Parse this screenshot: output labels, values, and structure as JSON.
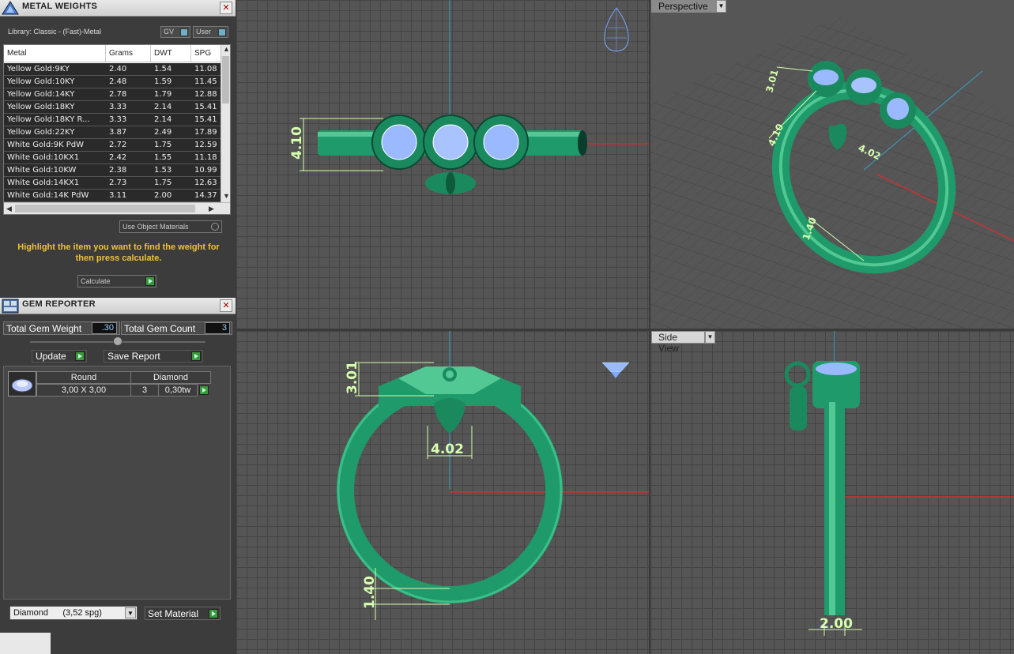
{
  "metal_weights": {
    "title": "METAL WEIGHTS",
    "library": "Library: Classic - (Fast)-Metal",
    "gv_label": "GV",
    "user_label": "User",
    "columns": [
      "Metal",
      "Grams",
      "DWT",
      "SPG"
    ],
    "rows": [
      [
        "Yellow Gold:9KY",
        "2.40",
        "1.54",
        "11.08"
      ],
      [
        "Yellow Gold:10KY",
        "2.48",
        "1.59",
        "11.45"
      ],
      [
        "Yellow Gold:14KY",
        "2.78",
        "1.79",
        "12.88"
      ],
      [
        "Yellow Gold:18KY",
        "3.33",
        "2.14",
        "15.41"
      ],
      [
        "Yellow Gold:18KY R...",
        "3.33",
        "2.14",
        "15.41"
      ],
      [
        "Yellow Gold:22KY",
        "3.87",
        "2.49",
        "17.89"
      ],
      [
        "White Gold:9K PdW",
        "2.72",
        "1.75",
        "12.59"
      ],
      [
        "White Gold:10KX1",
        "2.42",
        "1.55",
        "11.18"
      ],
      [
        "White Gold:10KW",
        "2.38",
        "1.53",
        "10.99"
      ],
      [
        "White Gold:14KX1",
        "2.73",
        "1.75",
        "12.63"
      ],
      [
        "White Gold:14K PdW",
        "3.11",
        "2.00",
        "14.37"
      ]
    ],
    "use_object_materials": "Use Object Materials",
    "hint": "Highlight the item you want to find the weight for then press calculate.",
    "calculate": "Calculate"
  },
  "gem_reporter": {
    "title": "GEM REPORTER",
    "total_weight_label": "Total Gem Weight",
    "total_weight_value": ".30",
    "total_count_label": "Total Gem Count",
    "total_count_value": "3",
    "update_label": "Update",
    "save_report_label": "Save Report",
    "gem": {
      "shape": "Round",
      "material": "Diamond",
      "size": "3,00 X 3,00",
      "count": "3",
      "weight": "0,30tw"
    },
    "material_select": "Diamond      (3,52 spg)",
    "set_material_label": "Set Material"
  },
  "viewports": {
    "top": {
      "dimension": "4.10"
    },
    "perspective": {
      "label": "Perspective",
      "dims": [
        "3.01",
        "4.10",
        "4.02",
        "1.40"
      ]
    },
    "front": {
      "dims": [
        "3.01",
        "4.02",
        "1.40"
      ]
    },
    "side": {
      "label": "Side View",
      "dimension": "2.00"
    }
  },
  "colors": {
    "metal_green": "#1f9a6a",
    "gem_blue": "#8fb0ff",
    "dimension": "#d7ffb0",
    "hint_yellow": "#f0c23a"
  }
}
